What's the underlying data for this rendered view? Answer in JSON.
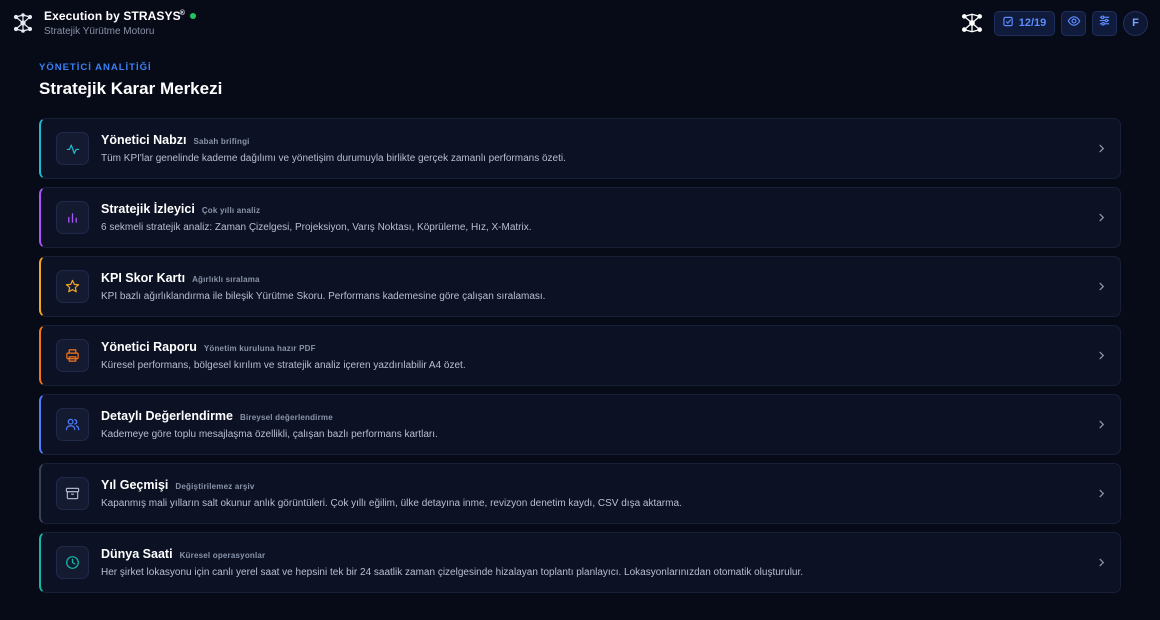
{
  "app": {
    "title": "Execution by STRASYS",
    "registered_mark": "®",
    "subtitle": "Stratejik Yürütme Motoru",
    "status_color": "#22c55e",
    "logo_icon": "network-nodes-icon"
  },
  "toolbar": {
    "progress_label": "12/19",
    "progress_icon": "checklist-icon",
    "view_icon": "eye-icon",
    "settings_icon": "sliders-icon",
    "avatar_initial": "F",
    "accent": "#5b8cff"
  },
  "page": {
    "eyebrow": "YÖNETİCİ ANALİTİĞİ",
    "title": "Stratejik Karar Merkezi"
  },
  "cards": [
    {
      "title": "Yönetici Nabzı",
      "tag": "Sabah brifingi",
      "desc": "Tüm KPI'lar genelinde kademe dağılımı ve yönetişim durumuyla birlikte gerçek zamanlı performans özeti.",
      "icon": "pulse-icon",
      "accent": "#22b8cf"
    },
    {
      "title": "Stratejik İzleyici",
      "tag": "Çok yıllı analiz",
      "desc": "6 sekmeli stratejik analiz: Zaman Çizelgesi, Projeksiyon, Varış Noktası, Köprüleme, Hız, X-Matrix.",
      "icon": "bar-chart-icon",
      "accent": "#a855f7"
    },
    {
      "title": "KPI Skor Kartı",
      "tag": "Ağırlıklı sıralama",
      "desc": "KPI bazlı ağırlıklandırma ile bileşik Yürütme Skoru. Performans kademesine göre çalışan sıralaması.",
      "icon": "star-icon",
      "accent": "#f5a524"
    },
    {
      "title": "Yönetici Raporu",
      "tag": "Yönetim kuruluna hazır PDF",
      "desc": "Küresel performans, bölgesel kırılım ve stratejik analiz içeren yazdırılabilir A4 özet.",
      "icon": "printer-icon",
      "accent": "#f97316"
    },
    {
      "title": "Detaylı Değerlendirme",
      "tag": "Bireysel değerlendirme",
      "desc": "Kademeye göre toplu mesajlaşma özellikli, çalışan bazlı performans kartları.",
      "icon": "users-icon",
      "accent": "#4f7dff"
    },
    {
      "title": "Yıl Geçmişi",
      "tag": "Değiştirilemez arşiv",
      "desc": "Kapanmış mali yılların salt okunur anlık görüntüleri. Çok yıllı eğilim, ülke detayına inme, revizyon denetim kaydı, CSV dışa aktarma.",
      "icon": "archive-icon",
      "accent": "#4b5568"
    },
    {
      "title": "Dünya Saati",
      "tag": "Küresel operasyonlar",
      "desc": "Her şirket lokasyonu için canlı yerel saat ve hepsini tek bir 24 saatlik zaman çizelgesinde hizalayan toplantı planlayıcı. Lokasyonlarınızdan otomatik oluşturulur.",
      "icon": "clock-icon",
      "accent": "#14b8a6"
    }
  ]
}
